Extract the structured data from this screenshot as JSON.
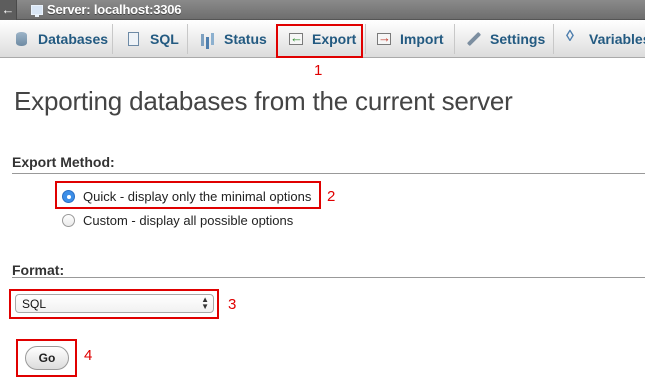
{
  "topbar": {
    "back_icon": "back-arrow-icon",
    "server_label": "Server: localhost:3306"
  },
  "tabs": [
    {
      "label": "Databases",
      "icon": "database-icon"
    },
    {
      "label": "SQL",
      "icon": "sql-icon"
    },
    {
      "label": "Status",
      "icon": "status-icon"
    },
    {
      "label": "Export",
      "icon": "export-icon"
    },
    {
      "label": "Import",
      "icon": "import-icon"
    },
    {
      "label": "Settings",
      "icon": "settings-icon"
    },
    {
      "label": "Variables",
      "icon": "variables-icon"
    }
  ],
  "main": {
    "title": "Exporting databases from the current server",
    "export_method": {
      "label": "Export Method:",
      "options": [
        {
          "label": "Quick - display only the minimal options",
          "checked": true
        },
        {
          "label": "Custom - display all possible options",
          "checked": false
        }
      ]
    },
    "format": {
      "label": "Format:",
      "selected": "SQL"
    },
    "go_label": "Go"
  },
  "annotations": {
    "color": "#e00000",
    "numbers": [
      "1",
      "2",
      "3",
      "4"
    ]
  }
}
